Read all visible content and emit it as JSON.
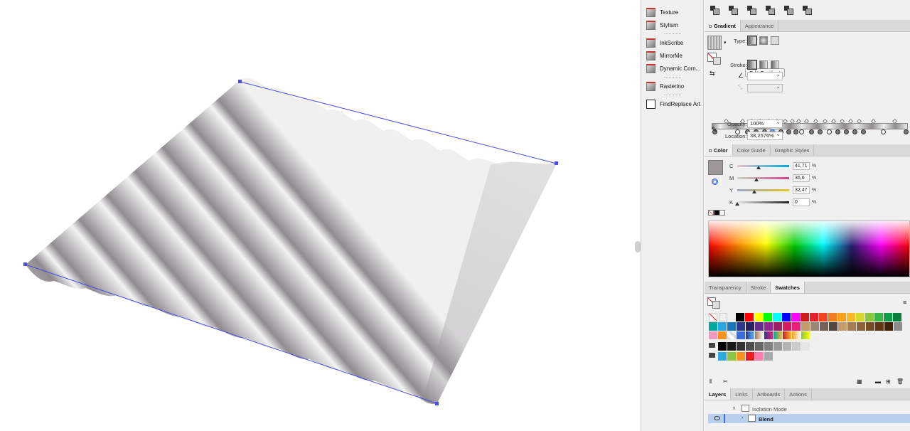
{
  "plugins": {
    "items": [
      {
        "label": "Texture",
        "icon": "texture-icon"
      },
      {
        "label": "Stylism",
        "icon": "stylism-icon"
      },
      {
        "label": "InkScribe",
        "icon": "inkscribe-icon"
      },
      {
        "label": "MirrorMe",
        "icon": "mirrorme-icon"
      },
      {
        "label": "Dynamic Corn...",
        "icon": "dynamic-corners-icon"
      },
      {
        "label": "Rasterino",
        "icon": "rasterino-icon"
      },
      {
        "label": "FindReplace Art",
        "icon": "findreplace-icon"
      }
    ]
  },
  "gradient_panel": {
    "tabs": [
      "Gradient",
      "Appearance"
    ],
    "type_label": "Type:",
    "edit_gradient": "Edit Gradient",
    "stroke_label": "Stroke:",
    "angle_value": "",
    "aspect_value": "",
    "opacity_label": "Opacity:",
    "opacity_value": "100%",
    "location_label": "Location:",
    "location_value": "38,2576%"
  },
  "color_panel": {
    "tabs": [
      "Color",
      "Color Guide",
      "Graphic Styles"
    ],
    "channels": [
      {
        "label": "C",
        "value": "41,71",
        "fraction": 0.4171
      },
      {
        "label": "M",
        "value": "36,6",
        "fraction": 0.366
      },
      {
        "label": "Y",
        "value": "32,47",
        "fraction": 0.3247
      },
      {
        "label": "K",
        "value": "0",
        "fraction": 0
      }
    ],
    "unit": "%",
    "fill_color": "#9b979b"
  },
  "swatches_panel": {
    "tabs": [
      "Transparency",
      "Stroke",
      "Swatches"
    ],
    "row1": [
      "#000000",
      "#ff0000",
      "#ffff00",
      "#00ff00",
      "#00ffff",
      "#0000ff",
      "#ff00ff",
      "#cc1a1f",
      "#e8202a",
      "#ef4424",
      "#f47c20",
      "#f9a11b",
      "#fbb829",
      "#d3d92a",
      "#8dc63f",
      "#39b54a",
      "#129e48",
      "#0a7f3f"
    ],
    "row2": [
      "#00a99d",
      "#2aa6dd",
      "#1b75bb",
      "#2b3990",
      "#262262",
      "#662d91",
      "#92278f",
      "#9e1f63",
      "#d91b5c",
      "#ec1e79",
      "#c49a6c",
      "#998675",
      "#736357",
      "#534741",
      "#c69c6d",
      "#a67c52",
      "#8c6239",
      "#754c24",
      "#603813",
      "#42210b",
      "#8d8d8d"
    ],
    "row4": [
      "#000000",
      "#1a1a1a",
      "#333333",
      "#4d4d4d",
      "#666666",
      "#808080",
      "#999999",
      "#b3b3b3",
      "#cccccc",
      "#e6e6e6"
    ],
    "row5": [
      "#29abe2",
      "#8cc63f",
      "#f7931e",
      "#ed1c24",
      "#ff7bac",
      "#a7a9ac"
    ]
  },
  "layers_panel": {
    "tabs": [
      "Layers",
      "Links",
      "Artboards",
      "Actions"
    ],
    "rows": [
      {
        "name": "Isolation Mode"
      },
      {
        "name": "Blend"
      }
    ]
  }
}
